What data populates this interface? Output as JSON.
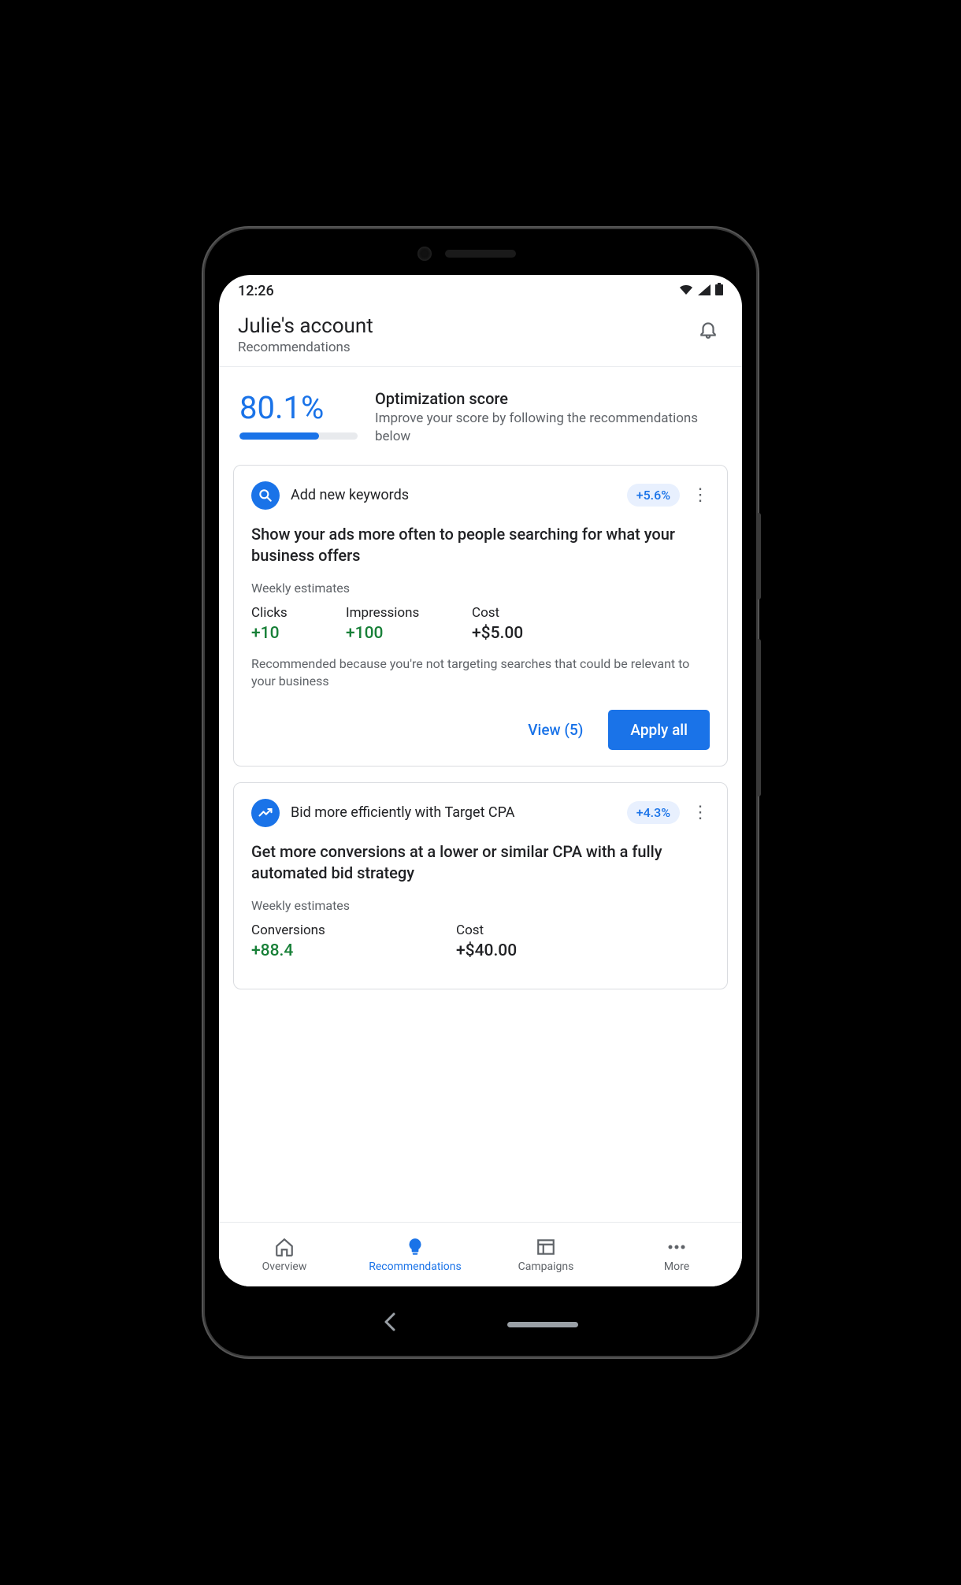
{
  "status": {
    "time": "12:26"
  },
  "header": {
    "title": "Julie's account",
    "subtitle": "Recommendations"
  },
  "optimization": {
    "percent": "80.1%",
    "fill_pct": 67,
    "title": "Optimization score",
    "description": "Improve your score by following the recommendations below"
  },
  "cards": [
    {
      "icon": "search",
      "title": "Add new keywords",
      "uplift": "+5.6%",
      "headline": "Show your ads more often to people searching for what your business offers",
      "estimates_label": "Weekly estimates",
      "metrics": [
        {
          "name": "Clicks",
          "value": "+10",
          "color": "green"
        },
        {
          "name": "Impressions",
          "value": "+100",
          "color": "green"
        },
        {
          "name": "Cost",
          "value": "+$5.00",
          "color": "black"
        }
      ],
      "reason": "Recommended because you're not targeting searches that could be relevant to your business",
      "view_label": "View (5)",
      "apply_label": "Apply all"
    },
    {
      "icon": "trend",
      "title": "Bid more efficiently with Target CPA",
      "uplift": "+4.3%",
      "headline": "Get more conversions at a lower or similar CPA with a fully automated bid strategy",
      "estimates_label": "Weekly estimates",
      "metrics": [
        {
          "name": "Conversions",
          "value": "+88.4",
          "color": "green"
        },
        {
          "name": "Cost",
          "value": "+$40.00",
          "color": "black"
        }
      ]
    }
  ],
  "nav": {
    "items": [
      {
        "label": "Overview",
        "active": false
      },
      {
        "label": "Recommendations",
        "active": true
      },
      {
        "label": "Campaigns",
        "active": false
      },
      {
        "label": "More",
        "active": false
      }
    ]
  }
}
